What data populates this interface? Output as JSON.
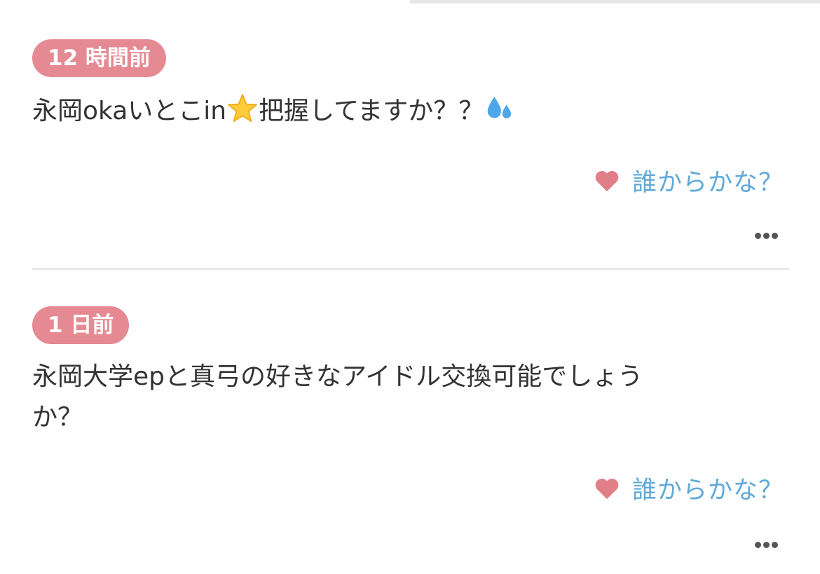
{
  "colors": {
    "badge_bg": "#e58a93",
    "heart": "#e07f88",
    "link": "#5fa9d8",
    "text": "#333333"
  },
  "posts": [
    {
      "time": "12 時間前",
      "question_before": "永岡okaいとこin",
      "question_after": "把握してますか？？",
      "emoji_inline_1": "star-emoji",
      "emoji_inline_2": "sweat-droplets-emoji",
      "who_label": "誰からかな？"
    },
    {
      "time": "1 日前",
      "question_line1": "永岡大学epと真弓の好きなアイドル交換可能でしょう",
      "question_line2": "か？",
      "who_label": "誰からかな？"
    }
  ]
}
